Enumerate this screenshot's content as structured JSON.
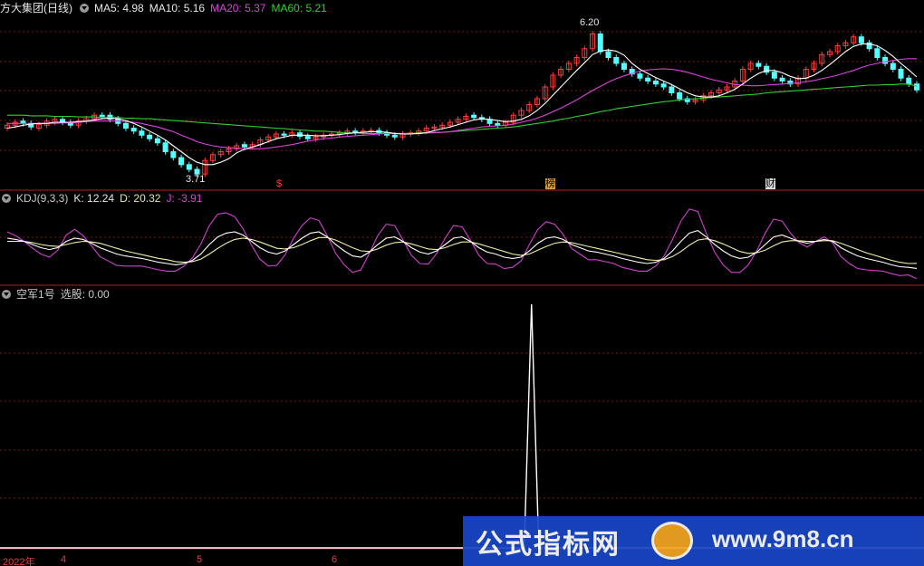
{
  "header_main": {
    "name": "方大集团(日线)",
    "ma5": "MA5: 4.98",
    "ma10": "MA10: 5.16",
    "ma20": "MA20: 5.37",
    "ma60": "MA60: 5.21"
  },
  "header_kdj": {
    "name": "KDJ(9,3,3)",
    "k": "K: 12.24",
    "d": "D: 20.32",
    "j": "J: -3.91"
  },
  "header_sel": {
    "name": "空军1号",
    "value": "选股: 0.00"
  },
  "annotations": {
    "high": "6.20",
    "low": "3.71",
    "mark_s": "$",
    "mark_bang": "榜",
    "mark_cai": "财"
  },
  "x_axis": {
    "labels": [
      "2022年",
      "4",
      "5",
      "6"
    ]
  },
  "watermark": {
    "text": "公式指标网",
    "url": "www.9m8.cn"
  },
  "colors": {
    "up": "#ff3c3c",
    "down": "#54ffff",
    "ma5": "#ffffff",
    "ma10": "#ffff00",
    "ma20": "#e040e0",
    "ma60": "#30d030",
    "grid": "#7a1a1a"
  },
  "chart_data": {
    "type": "candlestick",
    "close": [
      4.55,
      4.6,
      4.58,
      4.52,
      4.56,
      4.62,
      4.65,
      4.6,
      4.55,
      4.62,
      4.66,
      4.72,
      4.7,
      4.65,
      4.58,
      4.5,
      4.45,
      4.38,
      4.32,
      4.25,
      4.1,
      4.0,
      3.88,
      3.8,
      3.72,
      3.95,
      4.05,
      4.1,
      4.15,
      4.2,
      4.18,
      4.22,
      4.3,
      4.35,
      4.4,
      4.38,
      4.42,
      4.36,
      4.32,
      4.35,
      4.38,
      4.4,
      4.42,
      4.45,
      4.43,
      4.45,
      4.46,
      4.42,
      4.38,
      4.35,
      4.4,
      4.42,
      4.45,
      4.5,
      4.52,
      4.55,
      4.6,
      4.65,
      4.7,
      4.68,
      4.65,
      4.58,
      4.55,
      4.6,
      4.72,
      4.8,
      4.9,
      5.0,
      5.2,
      5.4,
      5.5,
      5.6,
      5.7,
      5.85,
      6.1,
      5.8,
      5.7,
      5.6,
      5.5,
      5.42,
      5.35,
      5.3,
      5.25,
      5.2,
      5.1,
      5.0,
      4.95,
      4.98,
      5.05,
      5.1,
      5.15,
      5.2,
      5.3,
      5.5,
      5.6,
      5.55,
      5.45,
      5.35,
      5.3,
      5.25,
      5.35,
      5.5,
      5.6,
      5.75,
      5.8,
      5.9,
      5.95,
      6.05,
      5.95,
      5.85,
      5.7,
      5.6,
      5.5,
      5.35,
      5.25,
      5.15
    ],
    "open": [
      4.5,
      4.55,
      4.62,
      4.58,
      4.5,
      4.55,
      4.6,
      4.65,
      4.6,
      4.55,
      4.62,
      4.66,
      4.72,
      4.72,
      4.66,
      4.58,
      4.5,
      4.45,
      4.38,
      4.32,
      4.25,
      4.1,
      4.0,
      3.88,
      3.8,
      3.72,
      3.95,
      4.05,
      4.1,
      4.15,
      4.22,
      4.18,
      4.22,
      4.3,
      4.35,
      4.4,
      4.38,
      4.42,
      4.36,
      4.32,
      4.35,
      4.38,
      4.4,
      4.42,
      4.45,
      4.43,
      4.45,
      4.46,
      4.42,
      4.38,
      4.35,
      4.4,
      4.42,
      4.45,
      4.5,
      4.52,
      4.55,
      4.6,
      4.65,
      4.72,
      4.68,
      4.65,
      4.58,
      4.55,
      4.6,
      4.72,
      4.8,
      4.9,
      5.0,
      5.2,
      5.4,
      5.5,
      5.6,
      5.7,
      5.85,
      6.1,
      5.8,
      5.7,
      5.6,
      5.5,
      5.42,
      5.35,
      5.3,
      5.25,
      5.2,
      5.1,
      5.0,
      4.95,
      4.98,
      5.05,
      5.1,
      5.15,
      5.2,
      5.3,
      5.5,
      5.6,
      5.55,
      5.45,
      5.35,
      5.3,
      5.25,
      5.35,
      5.5,
      5.6,
      5.75,
      5.8,
      5.9,
      5.95,
      6.05,
      5.95,
      5.85,
      5.7,
      5.6,
      5.5,
      5.35,
      5.25
    ],
    "ma5": [
      4.5,
      4.52,
      4.55,
      4.57,
      4.58,
      4.58,
      4.6,
      4.6,
      4.6,
      4.61,
      4.62,
      4.64,
      4.66,
      4.67,
      4.66,
      4.63,
      4.58,
      4.52,
      4.45,
      4.38,
      4.3,
      4.2,
      4.1,
      4.0,
      3.92,
      3.88,
      3.88,
      3.92,
      3.98,
      4.08,
      4.14,
      4.18,
      4.22,
      4.27,
      4.32,
      4.35,
      4.38,
      4.38,
      4.38,
      4.37,
      4.37,
      4.38,
      4.39,
      4.41,
      4.42,
      4.43,
      4.44,
      4.44,
      4.43,
      4.41,
      4.4,
      4.4,
      4.41,
      4.42,
      4.46,
      4.49,
      4.52,
      4.56,
      4.6,
      4.64,
      4.66,
      4.65,
      4.63,
      4.61,
      4.62,
      4.65,
      4.71,
      4.8,
      4.92,
      5.06,
      5.2,
      5.34,
      5.48,
      5.61,
      5.75,
      5.81,
      5.83,
      5.81,
      5.74,
      5.6,
      5.5,
      5.43,
      5.36,
      5.3,
      5.24,
      5.17,
      5.1,
      5.05,
      5.03,
      5.03,
      5.05,
      5.1,
      5.16,
      5.25,
      5.35,
      5.43,
      5.48,
      5.48,
      5.44,
      5.38,
      5.34,
      5.35,
      5.4,
      5.48,
      5.58,
      5.69,
      5.8,
      5.89,
      5.93,
      5.93,
      5.9,
      5.82,
      5.72,
      5.6,
      5.49,
      5.37
    ],
    "ma20": [
      4.58,
      4.58,
      4.58,
      4.58,
      4.58,
      4.58,
      4.58,
      4.59,
      4.59,
      4.6,
      4.61,
      4.62,
      4.62,
      4.62,
      4.62,
      4.61,
      4.6,
      4.58,
      4.55,
      4.52,
      4.48,
      4.44,
      4.38,
      4.33,
      4.27,
      4.23,
      4.2,
      4.18,
      4.17,
      4.16,
      4.15,
      4.15,
      4.15,
      4.16,
      4.18,
      4.2,
      4.22,
      4.25,
      4.28,
      4.3,
      4.32,
      4.33,
      4.35,
      4.36,
      4.37,
      4.38,
      4.39,
      4.4,
      4.41,
      4.41,
      4.41,
      4.41,
      4.41,
      4.42,
      4.42,
      4.43,
      4.44,
      4.46,
      4.48,
      4.5,
      4.52,
      4.53,
      4.54,
      4.55,
      4.57,
      4.6,
      4.63,
      4.67,
      4.72,
      4.78,
      4.84,
      4.91,
      4.98,
      5.06,
      5.14,
      5.21,
      5.28,
      5.34,
      5.39,
      5.43,
      5.47,
      5.49,
      5.5,
      5.51,
      5.5,
      5.48,
      5.45,
      5.41,
      5.37,
      5.33,
      5.3,
      5.27,
      5.24,
      5.23,
      5.22,
      5.22,
      5.23,
      5.24,
      5.25,
      5.26,
      5.27,
      5.29,
      5.31,
      5.34,
      5.37,
      5.4,
      5.44,
      5.48,
      5.53,
      5.57,
      5.6,
      5.63,
      5.65,
      5.67,
      5.68,
      5.68
    ],
    "ma60": [
      4.72,
      4.72,
      4.72,
      4.71,
      4.71,
      4.71,
      4.7,
      4.7,
      4.7,
      4.69,
      4.69,
      4.69,
      4.68,
      4.68,
      4.68,
      4.67,
      4.67,
      4.66,
      4.66,
      4.65,
      4.64,
      4.63,
      4.62,
      4.61,
      4.6,
      4.59,
      4.58,
      4.57,
      4.56,
      4.55,
      4.54,
      4.53,
      4.52,
      4.51,
      4.5,
      4.49,
      4.48,
      4.47,
      4.46,
      4.45,
      4.45,
      4.44,
      4.43,
      4.42,
      4.42,
      4.41,
      4.41,
      4.41,
      4.41,
      4.41,
      4.41,
      4.41,
      4.42,
      4.42,
      4.43,
      4.43,
      4.44,
      4.45,
      4.46,
      4.47,
      4.48,
      4.49,
      4.5,
      4.51,
      4.52,
      4.54,
      4.56,
      4.58,
      4.6,
      4.62,
      4.65,
      4.67,
      4.7,
      4.72,
      4.75,
      4.78,
      4.8,
      4.83,
      4.85,
      4.87,
      4.89,
      4.91,
      4.93,
      4.95,
      4.96,
      4.98,
      4.99,
      5.0,
      5.01,
      5.02,
      5.03,
      5.04,
      5.05,
      5.06,
      5.07,
      5.08,
      5.1,
      5.11,
      5.12,
      5.13,
      5.14,
      5.15,
      5.16,
      5.17,
      5.18,
      5.19,
      5.2,
      5.21,
      5.22,
      5.23,
      5.23,
      5.24,
      5.24,
      5.25,
      5.25,
      5.21
    ],
    "kdj_k": [
      60,
      58,
      55,
      50,
      45,
      42,
      45,
      55,
      60,
      58,
      52,
      45,
      40,
      35,
      32,
      30,
      28,
      25,
      22,
      20,
      18,
      20,
      25,
      35,
      50,
      62,
      68,
      70,
      65,
      55,
      45,
      38,
      35,
      40,
      50,
      60,
      68,
      70,
      62,
      50,
      40,
      32,
      30,
      38,
      50,
      60,
      62,
      55,
      45,
      38,
      35,
      40,
      50,
      60,
      62,
      55,
      45,
      38,
      35,
      30,
      28,
      30,
      40,
      52,
      60,
      62,
      58,
      50,
      45,
      40,
      38,
      35,
      32,
      28,
      25,
      22,
      20,
      22,
      28,
      40,
      55,
      68,
      72,
      62,
      50,
      40,
      32,
      28,
      30,
      38,
      50,
      62,
      65,
      60,
      55,
      52,
      55,
      58,
      55,
      45,
      38,
      32,
      28,
      25,
      22,
      18,
      15,
      14,
      12.24
    ],
    "kdj_d": [
      55,
      55,
      55,
      53,
      50,
      48,
      47,
      50,
      53,
      55,
      54,
      52,
      48,
      44,
      40,
      37,
      34,
      31,
      28,
      26,
      23,
      22,
      23,
      27,
      35,
      44,
      52,
      58,
      60,
      58,
      54,
      49,
      44,
      43,
      45,
      50,
      56,
      61,
      61,
      57,
      51,
      45,
      40,
      39,
      43,
      49,
      53,
      54,
      51,
      47,
      43,
      42,
      45,
      50,
      54,
      54,
      51,
      47,
      43,
      39,
      35,
      33,
      35,
      41,
      47,
      52,
      54,
      53,
      50,
      47,
      44,
      41,
      38,
      35,
      32,
      29,
      26,
      25,
      26,
      31,
      39,
      49,
      57,
      59,
      56,
      51,
      45,
      39,
      36,
      37,
      41,
      48,
      54,
      56,
      56,
      55,
      55,
      56,
      56,
      52,
      47,
      42,
      37,
      33,
      29,
      25,
      22,
      20,
      20.32
    ],
    "kdj_j": [
      70,
      64,
      55,
      44,
      35,
      30,
      41,
      65,
      74,
      64,
      48,
      31,
      24,
      17,
      16,
      16,
      16,
      13,
      10,
      8,
      8,
      16,
      29,
      51,
      80,
      98,
      100,
      94,
      75,
      49,
      27,
      16,
      17,
      34,
      60,
      80,
      92,
      88,
      64,
      36,
      18,
      6,
      10,
      36,
      64,
      82,
      80,
      57,
      33,
      20,
      19,
      36,
      60,
      80,
      78,
      57,
      33,
      20,
      19,
      12,
      14,
      24,
      50,
      74,
      86,
      82,
      66,
      44,
      35,
      26,
      26,
      23,
      20,
      14,
      11,
      8,
      8,
      16,
      32,
      58,
      87,
      106,
      102,
      68,
      38,
      18,
      6,
      6,
      18,
      40,
      68,
      90,
      87,
      68,
      53,
      46,
      55,
      62,
      53,
      31,
      20,
      12,
      10,
      9,
      8,
      4,
      1,
      2,
      -3.91
    ],
    "signal": {
      "peak_index": 64,
      "peak": 1.0,
      "baseline": 0.0
    }
  }
}
